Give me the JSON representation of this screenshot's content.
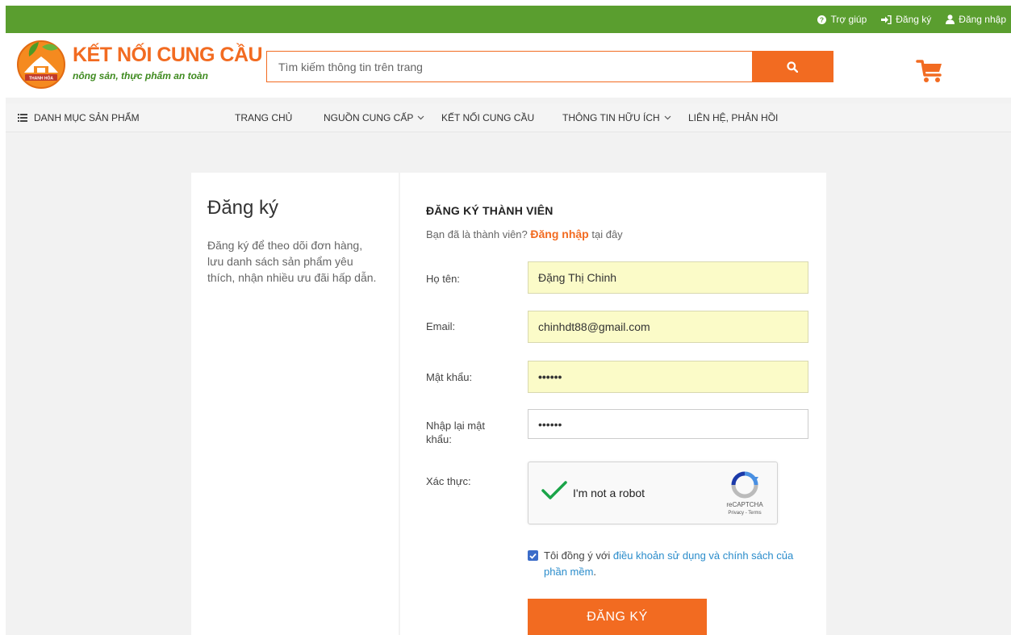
{
  "topbar": {
    "help": "Trợ giúp",
    "register": "Đăng ký",
    "login": "Đăng nhập"
  },
  "header": {
    "logo_title": "KẾT NỐI CUNG CẦU",
    "logo_tagline": "nông sản, thực phẩm an toàn",
    "logo_badge": "THANH HÓA",
    "search_placeholder": "Tìm kiếm thông tin trên trang"
  },
  "nav": {
    "categories": "DANH MỤC SẢN PHẨM",
    "items": [
      {
        "label": "TRANG CHỦ"
      },
      {
        "label": "NGUỒN CUNG CẤP"
      },
      {
        "label": "KẾT NỐI CUNG CẦU"
      },
      {
        "label": "THÔNG TIN HỮU ÍCH"
      },
      {
        "label": "LIÊN HỆ, PHẢN HỒI"
      }
    ]
  },
  "intro": {
    "title": "Đăng ký",
    "description": "Đăng ký để theo dõi đơn hàng, lưu danh sách sản phẩm yêu thích, nhận nhiều ưu đãi hấp dẫn."
  },
  "form": {
    "title": "ĐĂNG KÝ THÀNH VIÊN",
    "member_prompt": "Bạn đã là thành viên?",
    "login_link": "Đăng nhập",
    "login_suffix": "tại đây",
    "fullname_label": "Họ tên:",
    "fullname_value": "Đặng Thị Chinh",
    "email_label": "Email:",
    "email_value": "chinhdt88@gmail.com",
    "password_label": "Mật khẩu:",
    "password_value": "••••••",
    "confirm_label": "Nhập lại mật khẩu:",
    "confirm_value": "••••••",
    "verify_label": "Xác thực:",
    "captcha_text": "I'm not a robot",
    "captcha_brand": "reCAPTCHA",
    "captcha_terms": "Privacy - Terms",
    "agree_prefix": "Tôi đồng ý với",
    "agree_link": "điều khoản sử dụng và chính sách của phần mềm",
    "agree_suffix": ".",
    "agree_checked": true,
    "submit_label": "ĐĂNG KÝ"
  },
  "colors": {
    "brand_green": "#5a9e2f",
    "brand_orange": "#f26b21",
    "link_blue": "#2a8ccb",
    "field_highlight": "#fbfbc8"
  }
}
